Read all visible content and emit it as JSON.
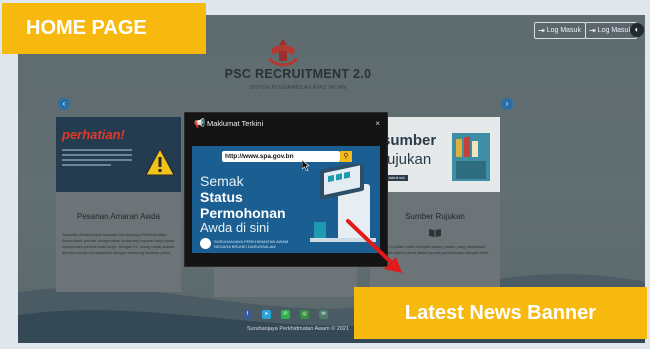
{
  "header": {
    "title": "PSC RECRUITMENT 2.0",
    "subtitle": "SISTEM PENGAMBILAN ATAS TALIAN",
    "login_buttons": [
      "Log Masuk",
      "Log Masuk"
    ]
  },
  "cards": [
    {
      "image_text": "perhatian!",
      "title": "Pesanan Amaran Awda",
      "text": "Sukacita dimaklumkan bahawa Suruhanjaya Perkhidmatan Awam tidak pernah mengenakan sebarang bayaran bagi tujuan memproses permohonan kerja. Dengan ini, orang ramai adalah diminta supaya berwaspada dengan sebarang tawaran palsu."
    },
    {
      "image_text": "",
      "title": "",
      "text": ""
    },
    {
      "image_text_1": "sumber",
      "image_text_2": "rujukan",
      "image_button": "Lihat di sini",
      "title": "Sumber Rujukan",
      "text": "Sumber rujukan boleh didapati dalam pautan yang disediakan untuk membantu anda dalam proses permohonan dengan lebih baik."
    }
  ],
  "modal": {
    "title": "Maklumat Terkini",
    "close": "×",
    "banner": {
      "url": "http://www.spa.gov.bn",
      "line1": "Semak",
      "line2": "Status",
      "line3": "Permohonan",
      "line4": "Awda di sini",
      "footer_line1": "SURUHANJAYA PERKHIDMATAN AWAM",
      "footer_line2": "NEGARA BRUNEI DARUSSALAM"
    }
  },
  "social_icons": [
    "facebook-icon",
    "telegram-icon",
    "whatsapp-icon",
    "instagram-icon",
    "email-icon"
  ],
  "footer": "Suruhanjaya Perkhidmatan Awam © 2021",
  "annotations": {
    "home": "HOME PAGE",
    "news": "Latest News Banner"
  },
  "colors": {
    "label": "#f8b90f",
    "arrow": "#e11a1a",
    "banner": "#1b5e92",
    "nav": "#2a6ea7"
  }
}
